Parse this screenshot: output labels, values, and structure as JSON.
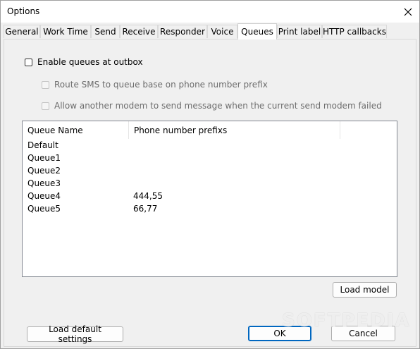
{
  "window": {
    "title": "Options"
  },
  "tabs": [
    {
      "label": "General"
    },
    {
      "label": "Work Time"
    },
    {
      "label": "Send"
    },
    {
      "label": "Receive"
    },
    {
      "label": "Responder"
    },
    {
      "label": "Voice"
    },
    {
      "label": "Queues"
    },
    {
      "label": "Print label"
    },
    {
      "label": "HTTP callbacks"
    }
  ],
  "active_tab": "Queues",
  "options": {
    "enable_queues": {
      "label": "Enable queues at outbox",
      "checked": false
    },
    "route_sms": {
      "label": "Route SMS to queue base on phone number prefix",
      "checked": false
    },
    "allow_modem": {
      "label": "Allow another modem to send message when the current send modem failed",
      "checked": false
    }
  },
  "queue_table": {
    "columns": [
      "Queue Name",
      "Phone number prefixs"
    ],
    "rows": [
      {
        "name": "Default",
        "prefixes": ""
      },
      {
        "name": "Queue1",
        "prefixes": ""
      },
      {
        "name": "Queue2",
        "prefixes": ""
      },
      {
        "name": "Queue3",
        "prefixes": ""
      },
      {
        "name": "Queue4",
        "prefixes": "444,55"
      },
      {
        "name": "Queue5",
        "prefixes": "66,77"
      }
    ]
  },
  "buttons": {
    "load_model": "Load model",
    "load_default": "Load default settings",
    "ok": "OK",
    "cancel": "Cancel"
  },
  "watermark": "SOFTPEDIA"
}
